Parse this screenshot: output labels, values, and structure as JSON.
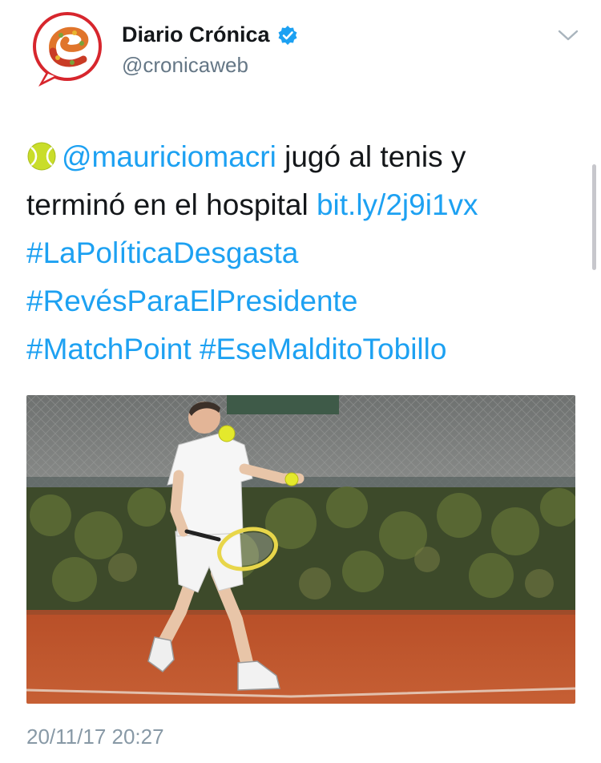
{
  "author": {
    "name": "Diario Crónica",
    "handle": "@cronicaweb",
    "verified": true,
    "avatar_icon": "cronica-logo-icon",
    "verified_icon": "verified-badge-icon"
  },
  "header": {
    "menu_icon": "chevron-down-icon"
  },
  "tweet": {
    "emoji": "tennis-ball-icon",
    "mention": "@mauriciomacri",
    "text_part1": " jugó al tenis y",
    "text_part2": "terminó en el hospital ",
    "link": "bit.ly/2j9i1vx",
    "hashtags": [
      "#LaPolíticaDesgasta",
      "#RevésParaElPresidente",
      "#MatchPoint",
      "#EseMalditoTobillo"
    ]
  },
  "media": {
    "type": "photo"
  },
  "timestamp": "20/11/17 20:27",
  "colors": {
    "link": "#1da1f2",
    "text": "#14171a",
    "secondary": "#657786",
    "verified": "#1da1f2",
    "clay_court": "#c2552c"
  }
}
